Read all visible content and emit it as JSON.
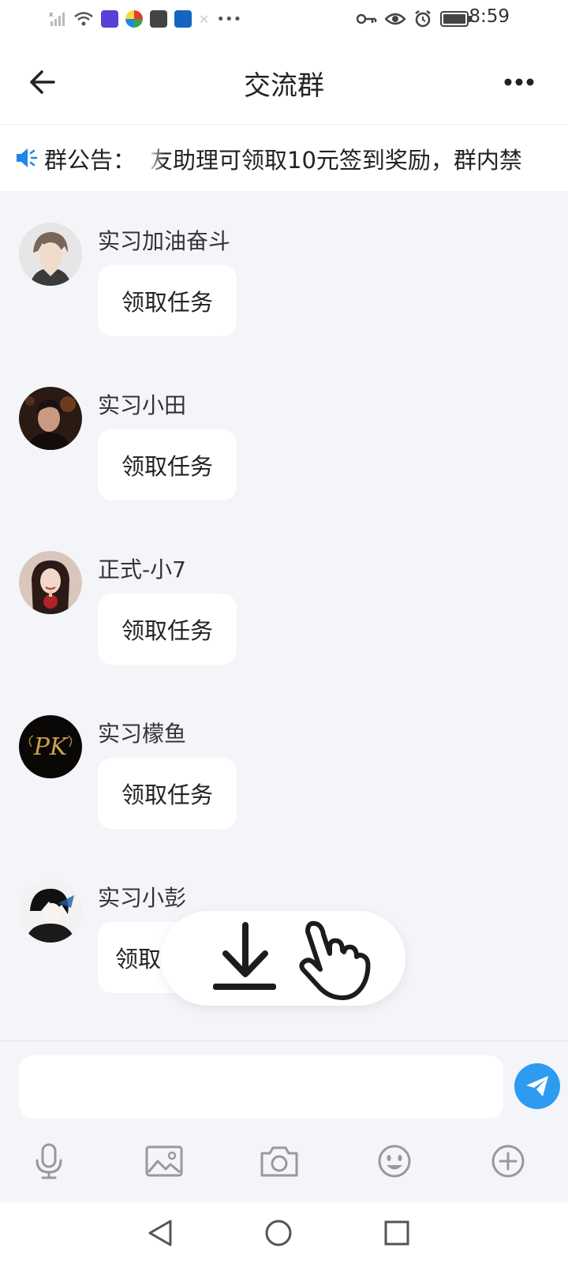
{
  "status_bar": {
    "time": "8:59"
  },
  "header": {
    "title": "交流群"
  },
  "notice": {
    "label": "群公告：",
    "text": "友助理可领取10元签到奖励，群内禁"
  },
  "messages": [
    {
      "sender": "实习加油奋斗",
      "text": "领取任务"
    },
    {
      "sender": "实习小田",
      "text": "领取任务"
    },
    {
      "sender": "正式-小7",
      "text": "领取任务"
    },
    {
      "sender": "实习檬鱼",
      "text": "领取任务"
    },
    {
      "sender": "实习小彭",
      "text": "领取"
    }
  ],
  "avatar_5": {
    "monogram": "PK"
  },
  "input": {
    "value": "",
    "placeholder": ""
  },
  "colors": {
    "accent": "#2d9cf0",
    "background": "#f4f5f9",
    "bubble": "#ffffff"
  },
  "icons": {
    "toolbar": [
      "microphone-icon",
      "image-icon",
      "camera-icon",
      "emoji-icon",
      "plus-circle-icon"
    ],
    "nav": [
      "back-triangle-icon",
      "home-circle-icon",
      "recents-square-icon"
    ]
  }
}
